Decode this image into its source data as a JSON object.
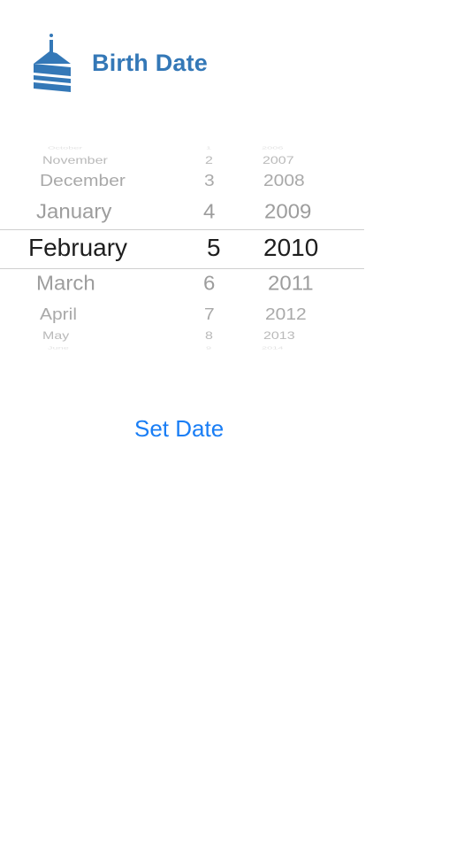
{
  "header": {
    "title": "Birth Date",
    "icon": "birthday-cake-icon",
    "accent_color": "#3478b7"
  },
  "picker": {
    "months": [
      "October",
      "November",
      "December",
      "January",
      "February",
      "March",
      "April",
      "May",
      "June"
    ],
    "days": [
      "1",
      "2",
      "3",
      "4",
      "5",
      "6",
      "7",
      "8",
      "9"
    ],
    "years": [
      "2006",
      "2007",
      "2008",
      "2009",
      "2010",
      "2011",
      "2012",
      "2013",
      "2014"
    ],
    "selected": {
      "month": "February",
      "day": "5",
      "year": "2010"
    }
  },
  "actions": {
    "set_date_label": "Set Date",
    "link_color": "#1a7ef5"
  }
}
